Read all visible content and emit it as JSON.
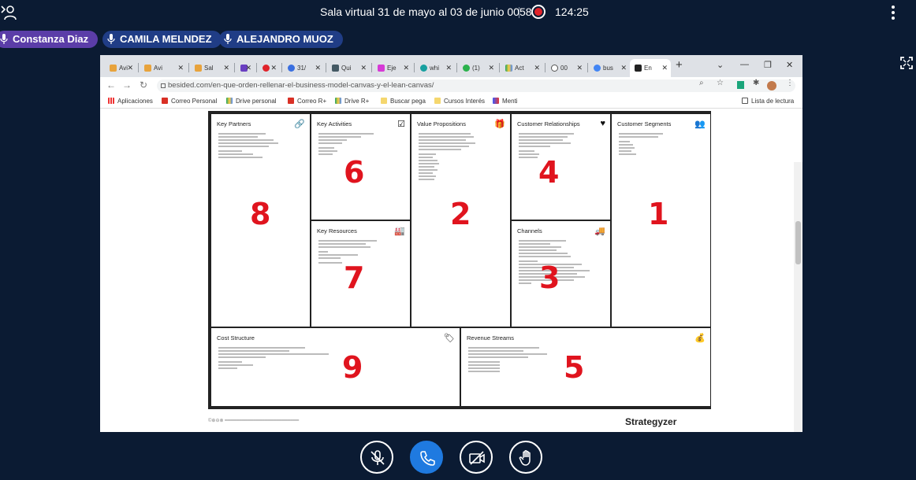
{
  "meeting": {
    "title": "Sala virtual 31 de mayo al 03 de junio 0058",
    "timer": "124:25"
  },
  "participants": [
    {
      "name": "Constanza Diaz",
      "color": "#5b3da8"
    },
    {
      "name": "CAMILA MELNDEZ",
      "color": "#203d86"
    },
    {
      "name": "ALEJANDRO MUOZ",
      "color": "#203d86"
    }
  ],
  "browser": {
    "tabs": [
      {
        "label": "Avi",
        "icon": "avi-icon"
      },
      {
        "label": "Avi",
        "icon": "avi-icon"
      },
      {
        "label": "Sal",
        "icon": "sala-icon"
      },
      {
        "label": "",
        "icon": "app-icon"
      },
      {
        "label": "",
        "icon": "rec-icon"
      },
      {
        "label": "31/",
        "icon": "c-icon"
      },
      {
        "label": "Qui",
        "icon": "quiz-icon"
      },
      {
        "label": "Eje",
        "icon": "chart-icon"
      },
      {
        "label": "whi",
        "icon": "w-icon"
      },
      {
        "label": "(1)",
        "icon": "one-icon"
      },
      {
        "label": "Act",
        "icon": "drive-icon"
      },
      {
        "label": "00",
        "icon": "check-icon"
      },
      {
        "label": "bus",
        "icon": "google-icon"
      },
      {
        "label": "En",
        "icon": "strategyzer-icon"
      }
    ],
    "url": "besided.com/en-que-orden-rellenar-el-business-model-canvas-y-el-lean-canvas/",
    "bookmarks": [
      {
        "label": "Aplicaciones"
      },
      {
        "label": "Correo Personal"
      },
      {
        "label": "Drive personal"
      },
      {
        "label": "Correo R+"
      },
      {
        "label": "Drive R+"
      },
      {
        "label": "Buscar pega"
      },
      {
        "label": "Cursos Interés"
      },
      {
        "label": "Menti"
      }
    ],
    "reading_list": "Lista de lectura"
  },
  "canvas": {
    "key_partners": {
      "title": "Key Partners",
      "number": "8",
      "icon": "link-icon"
    },
    "key_activities": {
      "title": "Key Activities",
      "number": "6",
      "icon": "checkbox-icon"
    },
    "key_resources": {
      "title": "Key Resources",
      "number": "7",
      "icon": "factory-icon"
    },
    "value_propositions": {
      "title": "Value Propositions",
      "number": "2",
      "icon": "gift-icon"
    },
    "customer_relationships": {
      "title": "Customer Relationships",
      "number": "4",
      "icon": "heart-icon"
    },
    "channels": {
      "title": "Channels",
      "number": "3",
      "icon": "truck-icon"
    },
    "customer_segments": {
      "title": "Customer Segments",
      "number": "1",
      "icon": "people-icon"
    },
    "cost_structure": {
      "title": "Cost Structure",
      "number": "9",
      "icon": "tag-icon"
    },
    "revenue_streams": {
      "title": "Revenue Streams",
      "number": "5",
      "icon": "moneybag-icon"
    },
    "brand": "Strategyzer"
  },
  "controls": [
    "mute-mic",
    "end-call",
    "camera-off",
    "raise-hand"
  ]
}
